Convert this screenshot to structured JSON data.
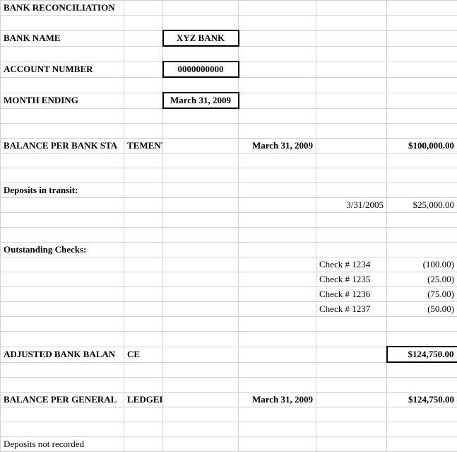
{
  "header": {
    "title": "BANK RECONCILIATION",
    "bank_name_label": "BANK NAME",
    "bank_name_value": "XYZ BANK",
    "account_number_label": "ACCOUNT NUMBER",
    "account_number_value": "0000000000",
    "month_ending_label": "MONTH ENDING",
    "month_ending_value": "March 31, 2009"
  },
  "balance_per_bank": {
    "label_a": "BALANCE PER BANK STA",
    "label_b": "TEMENT",
    "date": "March 31, 2009",
    "amount": "$100,000.00"
  },
  "deposits_in_transit": {
    "label": "Deposits in transit:",
    "items": [
      {
        "date": "3/31/2005",
        "amount": "$25,000.00"
      }
    ]
  },
  "outstanding_checks": {
    "label": "Outstanding Checks:",
    "items": [
      {
        "desc": "Check # 1234",
        "amount": "(100.00)"
      },
      {
        "desc": "Check # 1235",
        "amount": "(25.00)"
      },
      {
        "desc": "Check # 1236",
        "amount": "(75.00)"
      },
      {
        "desc": "Check # 1237",
        "amount": "(50.00)"
      }
    ]
  },
  "adjusted_bank_balance": {
    "label_a": "ADJUSTED BANK BALAN",
    "label_b": "CE",
    "amount": "$124,750.00"
  },
  "balance_per_gl": {
    "label_a": "BALANCE PER GENERAL",
    "label_b": " LEDGER",
    "date": "March 31, 2009",
    "amount": "$124,750.00"
  },
  "deposits_not_recorded": {
    "label": "Deposits not recorded"
  }
}
